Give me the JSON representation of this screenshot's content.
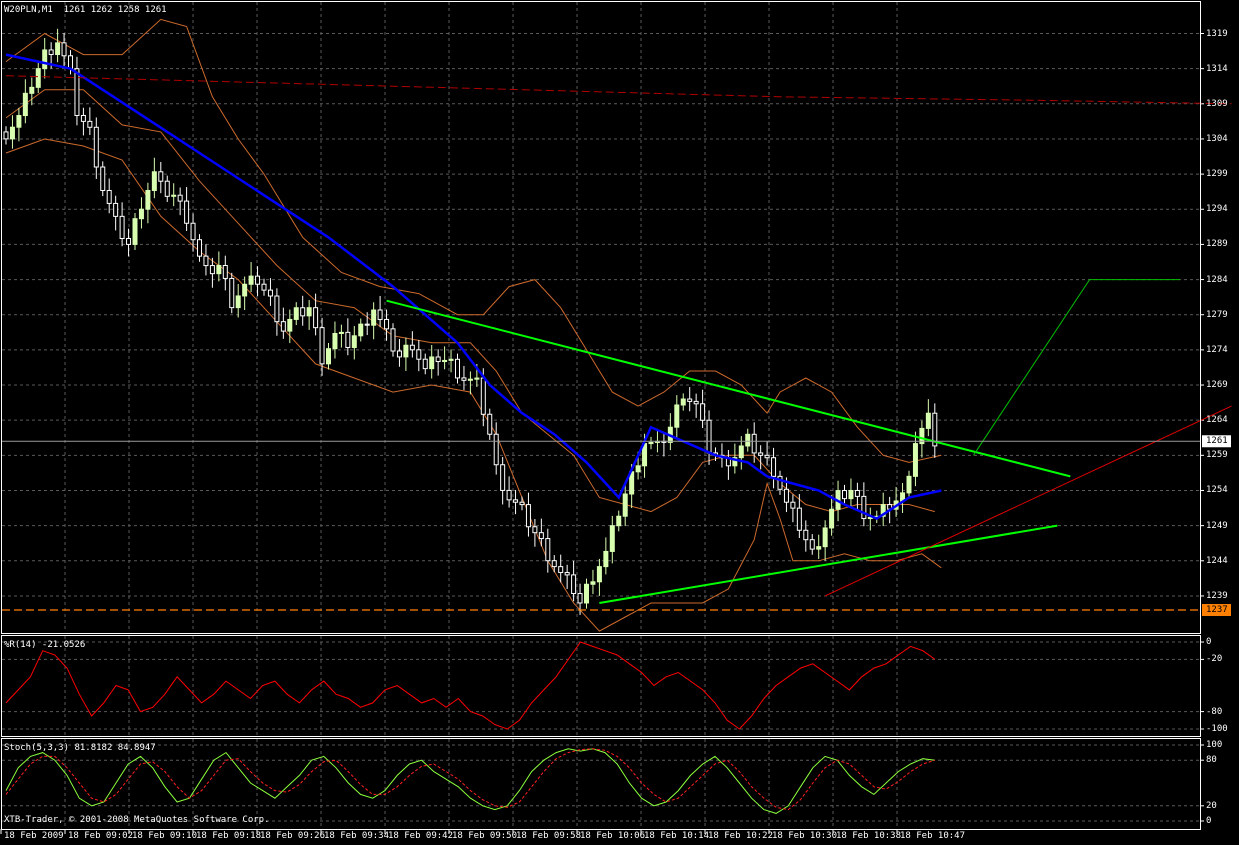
{
  "header": {
    "symbol": "W20PLN,M1",
    "ohlc": "1261 1262 1258 1261",
    "wpr_label": "%R(14) -21.0526",
    "stoch_label": "Stoch(5,3,3) 81.8182 84.8947",
    "copyright": "XTB-Trader, © 2001-2008 MetaQuotes Software Corp."
  },
  "colors": {
    "background": "#000000",
    "grid": "#5a5a5a",
    "bull": "#d8ffb0",
    "bear": "#ffffff",
    "ma": "#0000ff",
    "bands": "#cd6a2c",
    "trend": "#00ff00",
    "wpr": "#ff0000",
    "stoch_main": "#8cff3c",
    "stoch_signal": "#ff2020"
  },
  "chart_data": [
    {
      "type": "candlestick",
      "panel": "price",
      "title": "W20PLN,M1",
      "ylim": [
        1235,
        1322
      ],
      "yticks": [
        1319,
        1314,
        1309,
        1304,
        1299,
        1294,
        1289,
        1284,
        1279,
        1274,
        1269,
        1264,
        1259,
        1254,
        1249,
        1244,
        1239
      ],
      "xticks": [
        "18 Feb 2009",
        "18 Feb 09:02",
        "18 Feb 09:10",
        "18 Feb 09:18",
        "18 Feb 09:26",
        "18 Feb 09:34",
        "18 Feb 09:42",
        "18 Feb 09:50",
        "18 Feb 09:58",
        "18 Feb 10:06",
        "18 Feb 10:14",
        "18 Feb 10:22",
        "18 Feb 10:30",
        "18 Feb 10:38",
        "18 Feb 10:47"
      ],
      "x_range_minutes": [
        0,
        150
      ],
      "current_price": 1261,
      "current_price_label": "1261",
      "level": 1237,
      "level_label": "1237",
      "close_path": [
        [
          0,
          1305
        ],
        [
          2,
          1307
        ],
        [
          4,
          1312
        ],
        [
          6,
          1316
        ],
        [
          8,
          1318
        ],
        [
          10,
          1313
        ],
        [
          11,
          1308
        ],
        [
          13,
          1305
        ],
        [
          15,
          1297
        ],
        [
          17,
          1292
        ],
        [
          19,
          1289
        ],
        [
          21,
          1295
        ],
        [
          23,
          1299
        ],
        [
          24,
          1297
        ],
        [
          26,
          1296
        ],
        [
          28,
          1293
        ],
        [
          30,
          1287
        ],
        [
          31,
          1285
        ],
        [
          33,
          1286
        ],
        [
          35,
          1281
        ],
        [
          37,
          1283
        ],
        [
          39,
          1284
        ],
        [
          41,
          1281
        ],
        [
          43,
          1277
        ],
        [
          45,
          1279
        ],
        [
          47,
          1280
        ],
        [
          49,
          1273
        ],
        [
          51,
          1276
        ],
        [
          53,
          1275
        ],
        [
          55,
          1277
        ],
        [
          57,
          1280
        ],
        [
          59,
          1276
        ],
        [
          61,
          1273
        ],
        [
          63,
          1275
        ],
        [
          65,
          1271
        ],
        [
          67,
          1273
        ],
        [
          69,
          1272
        ],
        [
          71,
          1270
        ],
        [
          73,
          1269
        ],
        [
          75,
          1262
        ],
        [
          76,
          1257
        ],
        [
          78,
          1253
        ],
        [
          80,
          1251
        ],
        [
          82,
          1248
        ],
        [
          84,
          1245
        ],
        [
          86,
          1242
        ],
        [
          88,
          1240
        ],
        [
          89,
          1238
        ],
        [
          91,
          1242
        ],
        [
          93,
          1245
        ],
        [
          95,
          1251
        ],
        [
          97,
          1256
        ],
        [
          99,
          1261
        ],
        [
          101,
          1260
        ],
        [
          103,
          1263
        ],
        [
          105,
          1268
        ],
        [
          107,
          1266
        ],
        [
          109,
          1260
        ],
        [
          111,
          1258
        ],
        [
          113,
          1259
        ],
        [
          115,
          1261
        ],
        [
          117,
          1259
        ],
        [
          119,
          1257
        ],
        [
          121,
          1252
        ],
        [
          123,
          1249
        ],
        [
          125,
          1245
        ],
        [
          127,
          1249
        ],
        [
          129,
          1253
        ],
        [
          131,
          1254
        ],
        [
          133,
          1251
        ],
        [
          135,
          1250
        ],
        [
          137,
          1252
        ],
        [
          139,
          1253
        ],
        [
          141,
          1261
        ],
        [
          143,
          1264
        ],
        [
          144,
          1261
        ]
      ],
      "series": [
        {
          "name": "MA",
          "points": [
            [
              0,
              1316
            ],
            [
              10,
              1314
            ],
            [
              20,
              1308
            ],
            [
              30,
              1302
            ],
            [
              40,
              1296
            ],
            [
              50,
              1290
            ],
            [
              60,
              1283
            ],
            [
              65,
              1279
            ],
            [
              70,
              1275
            ],
            [
              75,
              1269
            ],
            [
              80,
              1265
            ],
            [
              85,
              1262
            ],
            [
              90,
              1258
            ],
            [
              95,
              1253
            ],
            [
              100,
              1263
            ],
            [
              105,
              1261
            ],
            [
              110,
              1259
            ],
            [
              115,
              1258
            ],
            [
              118,
              1256
            ],
            [
              122,
              1255
            ],
            [
              126,
              1254
            ],
            [
              130,
              1252
            ],
            [
              135,
              1250
            ],
            [
              140,
              1253
            ],
            [
              145,
              1254
            ]
          ]
        },
        {
          "name": "BB upper",
          "points": [
            [
              0,
              1315
            ],
            [
              6,
              1319
            ],
            [
              12,
              1316
            ],
            [
              18,
              1316
            ],
            [
              24,
              1321
            ],
            [
              28,
              1320
            ],
            [
              32,
              1310
            ],
            [
              36,
              1304
            ],
            [
              40,
              1299
            ],
            [
              46,
              1290
            ],
            [
              52,
              1285
            ],
            [
              58,
              1283
            ],
            [
              64,
              1282
            ],
            [
              70,
              1279
            ],
            [
              74,
              1279
            ],
            [
              78,
              1283
            ],
            [
              82,
              1284
            ],
            [
              86,
              1280
            ],
            [
              90,
              1274
            ],
            [
              94,
              1268
            ],
            [
              98,
              1266
            ],
            [
              102,
              1268
            ],
            [
              106,
              1271
            ],
            [
              110,
              1271
            ],
            [
              114,
              1269
            ],
            [
              118,
              1265
            ],
            [
              120,
              1268
            ],
            [
              124,
              1270
            ],
            [
              128,
              1268
            ],
            [
              132,
              1263
            ],
            [
              136,
              1259
            ],
            [
              140,
              1258
            ],
            [
              145,
              1259
            ]
          ]
        },
        {
          "name": "BB middle",
          "points": [
            [
              0,
              1307
            ],
            [
              6,
              1311
            ],
            [
              12,
              1311
            ],
            [
              18,
              1306
            ],
            [
              24,
              1305
            ],
            [
              30,
              1298
            ],
            [
              36,
              1292
            ],
            [
              42,
              1286
            ],
            [
              48,
              1281
            ],
            [
              54,
              1280
            ],
            [
              60,
              1276
            ],
            [
              66,
              1275
            ],
            [
              72,
              1275
            ],
            [
              76,
              1271
            ],
            [
              80,
              1265
            ],
            [
              84,
              1262
            ],
            [
              88,
              1259
            ],
            [
              92,
              1253
            ],
            [
              96,
              1252
            ],
            [
              100,
              1251
            ],
            [
              104,
              1253
            ],
            [
              108,
              1258
            ],
            [
              112,
              1259
            ],
            [
              116,
              1259
            ],
            [
              120,
              1255
            ],
            [
              124,
              1252
            ],
            [
              128,
              1251
            ],
            [
              132,
              1252
            ],
            [
              136,
              1252
            ],
            [
              140,
              1252
            ],
            [
              144,
              1251
            ]
          ]
        },
        {
          "name": "BB lower",
          "points": [
            [
              0,
              1302
            ],
            [
              6,
              1304
            ],
            [
              12,
              1303
            ],
            [
              18,
              1301
            ],
            [
              24,
              1293
            ],
            [
              30,
              1288
            ],
            [
              36,
              1284
            ],
            [
              42,
              1278
            ],
            [
              48,
              1272
            ],
            [
              54,
              1270
            ],
            [
              60,
              1268
            ],
            [
              66,
              1269
            ],
            [
              72,
              1268
            ],
            [
              76,
              1262
            ],
            [
              80,
              1253
            ],
            [
              84,
              1244
            ],
            [
              88,
              1238
            ],
            [
              92,
              1234
            ],
            [
              96,
              1236
            ],
            [
              100,
              1238
            ],
            [
              104,
              1238
            ],
            [
              108,
              1238
            ],
            [
              112,
              1240
            ],
            [
              116,
              1247
            ],
            [
              118,
              1255
            ],
            [
              120,
              1250
            ],
            [
              122,
              1244
            ],
            [
              126,
              1244
            ],
            [
              130,
              1245
            ],
            [
              134,
              1244
            ],
            [
              138,
              1244
            ],
            [
              142,
              1245
            ],
            [
              145,
              1243
            ]
          ]
        },
        {
          "name": "Trend upper",
          "points": [
            [
              59,
              1281
            ],
            [
              165,
              1256
            ]
          ]
        },
        {
          "name": "Trend lower",
          "points": [
            [
              92,
              1238
            ],
            [
              163,
              1249
            ]
          ]
        },
        {
          "name": "Trend red",
          "points": [
            [
              127,
              1239
            ],
            [
              190,
              1266
            ]
          ]
        },
        {
          "name": "Forecast",
          "points": [
            [
              150,
              1259
            ],
            [
              168,
              1284
            ],
            [
              182,
              1284
            ]
          ]
        },
        {
          "name": "MA long",
          "points": [
            [
              0,
              1313
            ],
            [
              40,
              1312
            ],
            [
              80,
              1311
            ],
            [
              120,
              1310
            ],
            [
              160,
              1309.5
            ],
            [
              190,
              1309
            ]
          ]
        }
      ]
    },
    {
      "type": "line",
      "panel": "wpr",
      "title": "%R(14) -21.0526",
      "ylim": [
        -100,
        0
      ],
      "yticks": [
        0,
        -20,
        -80,
        -100
      ],
      "values": [
        -70,
        -55,
        -40,
        -10,
        -15,
        -30,
        -60,
        -85,
        -70,
        -50,
        -55,
        -80,
        -75,
        -60,
        -40,
        -55,
        -70,
        -60,
        -45,
        -55,
        -65,
        -50,
        -45,
        -60,
        -70,
        -55,
        -45,
        -60,
        -65,
        -75,
        -70,
        -55,
        -50,
        -60,
        -70,
        -65,
        -75,
        -65,
        -80,
        -85,
        -95,
        -100,
        -90,
        -70,
        -55,
        -40,
        -20,
        0,
        -5,
        -10,
        -15,
        -25,
        -35,
        -50,
        -40,
        -35,
        -45,
        -55,
        -70,
        -90,
        -100,
        -85,
        -65,
        -50,
        -40,
        -30,
        -25,
        -35,
        -45,
        -55,
        -40,
        -30,
        -25,
        -15,
        -5,
        -10,
        -20
      ]
    },
    {
      "type": "line",
      "panel": "stoch",
      "title": "Stoch(5,3,3) 81.8182 84.8947",
      "ylim": [
        0,
        100
      ],
      "yticks": [
        100,
        80,
        20,
        0
      ],
      "series": [
        {
          "name": "Main",
          "values": [
            40,
            70,
            85,
            90,
            80,
            60,
            30,
            20,
            25,
            50,
            75,
            85,
            70,
            45,
            25,
            30,
            55,
            80,
            90,
            70,
            50,
            40,
            30,
            45,
            60,
            80,
            85,
            70,
            50,
            35,
            30,
            40,
            60,
            75,
            80,
            65,
            55,
            45,
            30,
            20,
            15,
            20,
            40,
            65,
            80,
            90,
            95,
            92,
            95,
            90,
            75,
            50,
            30,
            20,
            25,
            40,
            60,
            75,
            85,
            70,
            50,
            30,
            15,
            10,
            20,
            45,
            70,
            85,
            80,
            60,
            45,
            35,
            50,
            65,
            75,
            82,
            80
          ]
        },
        {
          "name": "Signal",
          "values": [
            35,
            55,
            75,
            85,
            85,
            70,
            50,
            30,
            25,
            35,
            55,
            75,
            78,
            65,
            45,
            30,
            40,
            60,
            80,
            82,
            65,
            50,
            40,
            38,
            48,
            65,
            78,
            80,
            65,
            48,
            35,
            35,
            45,
            60,
            72,
            75,
            65,
            55,
            40,
            28,
            20,
            18,
            25,
            45,
            65,
            82,
            90,
            94,
            95,
            93,
            85,
            70,
            50,
            35,
            25,
            30,
            45,
            60,
            75,
            80,
            65,
            45,
            30,
            18,
            15,
            28,
            50,
            70,
            80,
            75,
            60,
            45,
            42,
            52,
            65,
            75,
            80
          ]
        }
      ]
    }
  ]
}
